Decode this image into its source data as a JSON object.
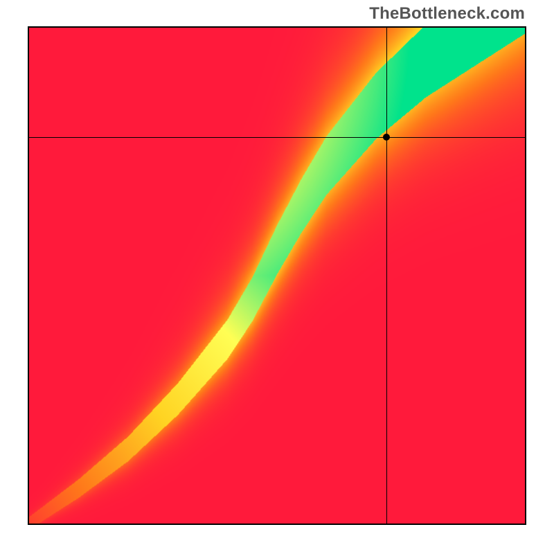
{
  "watermark": "TheBottleneck.com",
  "chart_data": {
    "type": "heatmap",
    "title": "",
    "xlabel": "",
    "ylabel": "",
    "xlim": [
      0,
      1
    ],
    "ylim": [
      0,
      1
    ],
    "colormap_stops": [
      {
        "t": 0.0,
        "color": "#ff1a3c"
      },
      {
        "t": 0.25,
        "color": "#ff7a1a"
      },
      {
        "t": 0.5,
        "color": "#ffd423"
      },
      {
        "t": 0.75,
        "color": "#ffff55"
      },
      {
        "t": 1.0,
        "color": "#00e38c"
      }
    ],
    "ridge": {
      "description": "Approximate optimal curve (green ridge) as polyline points in normalized (x,y) with y measured from bottom.",
      "points": [
        [
          0.0,
          0.0
        ],
        [
          0.1,
          0.07
        ],
        [
          0.2,
          0.15
        ],
        [
          0.3,
          0.25
        ],
        [
          0.4,
          0.37
        ],
        [
          0.45,
          0.45
        ],
        [
          0.5,
          0.55
        ],
        [
          0.55,
          0.64
        ],
        [
          0.6,
          0.72
        ],
        [
          0.65,
          0.78
        ],
        [
          0.7,
          0.84
        ],
        [
          0.8,
          0.93
        ],
        [
          0.9,
          1.0
        ]
      ],
      "half_width_frac": 0.05,
      "sharpness": 6.0
    },
    "corners_value": {
      "top_left": 0.0,
      "top_right": 0.55,
      "bottom_left": 0.0,
      "bottom_right": 0.0
    },
    "marker": {
      "x": 0.72,
      "y": 0.78
    }
  }
}
